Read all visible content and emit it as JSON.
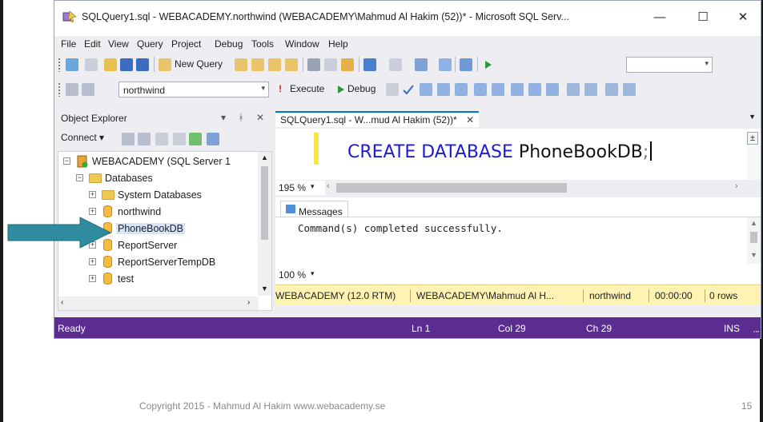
{
  "window": {
    "title": "SQLQuery1.sql - WEBACADEMY.northwind (WEBACADEMY\\Mahmud Al Hakim (52))* - Microsoft SQL Serv...",
    "controls": {
      "minimize": "—",
      "maximize": "☐",
      "close": "✕"
    }
  },
  "menu": [
    "File",
    "Edit",
    "View",
    "Query",
    "Project",
    "Debug",
    "Tools",
    "Window",
    "Help"
  ],
  "toolbar1": {
    "new_query": "New Query"
  },
  "toolbar2": {
    "database": "northwind",
    "execute": "Execute",
    "debug": "Debug"
  },
  "object_explorer": {
    "title": "Object Explorer",
    "pins": "▾ ᚼ ✕",
    "connect": "Connect ▾",
    "tree": [
      {
        "label": "WEBACADEMY (SQL Server 1",
        "expanded": true
      },
      {
        "label": "Databases",
        "expanded": true
      },
      {
        "label": "System Databases",
        "expanded": false
      },
      {
        "label": "northwind",
        "expanded": false
      },
      {
        "label": "PhoneBookDB",
        "expanded": false,
        "selected": true
      },
      {
        "label": "ReportServer",
        "expanded": false
      },
      {
        "label": "ReportServerTempDB",
        "expanded": false
      },
      {
        "label": "test",
        "expanded": false
      }
    ]
  },
  "editor": {
    "tab_label": "SQLQuery1.sql - W...mud Al Hakim (52))*",
    "tab_close": "✕",
    "code_kw1": "CREATE",
    "code_kw2": "DATABASE",
    "code_ident": "PhoneBookDB",
    "code_semi": ";",
    "zoom": "195 %"
  },
  "results": {
    "tab_label": "Messages",
    "message": "Command(s) completed successfully.",
    "zoom": "100 %"
  },
  "query_status": {
    "server": "WEBACADEMY (12.0 RTM)",
    "user": "WEBACADEMY\\Mahmud Al H...",
    "database": "northwind",
    "time": "00:00:00",
    "rows": "0 rows"
  },
  "statusbar": {
    "state": "Ready",
    "ln": "Ln 1",
    "col": "Col 29",
    "ch": "Ch 29",
    "mode": "INS"
  },
  "footer": {
    "copyright": "Copyright 2015 - Mahmud Al Hakim www.webacademy.se",
    "page": "15"
  },
  "colors": {
    "status_purple": "#5c2d91",
    "query_yellow": "#fff3b4",
    "arrow_teal": "#2f8ca0",
    "keyword_blue": "#1b1bd8"
  }
}
